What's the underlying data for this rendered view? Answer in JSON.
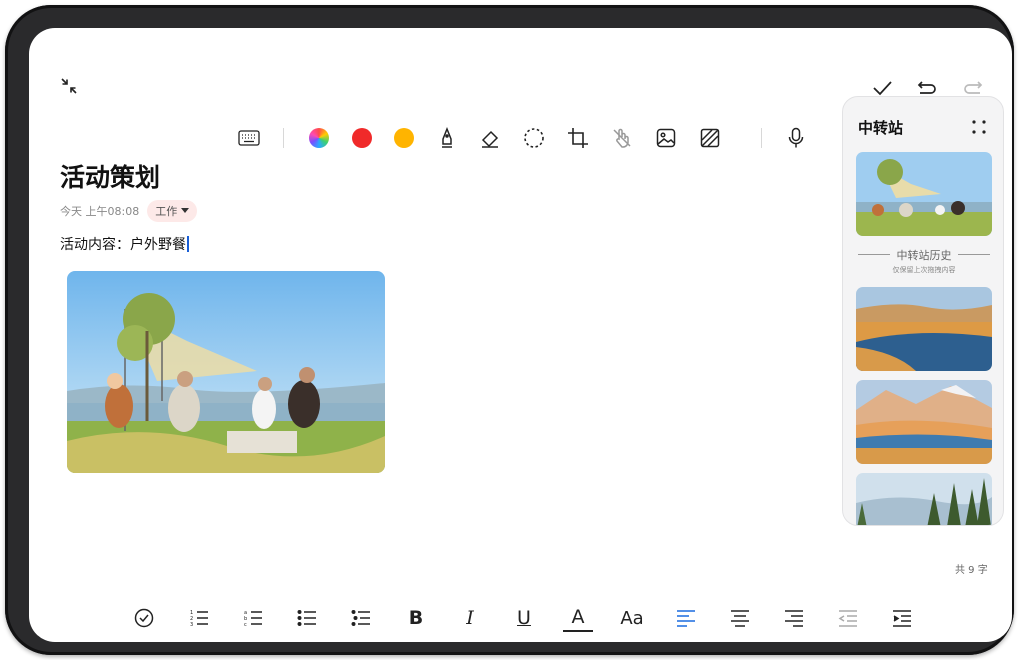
{
  "note": {
    "title": "活动策划",
    "time": "今天 上午08:08",
    "tag": "工作",
    "content": "活动内容：户外野餐"
  },
  "top_toolbar": {
    "icons": [
      "keyboard-icon",
      "color-wheel-icon",
      "red-color",
      "yellow-color",
      "pen-icon",
      "eraser-icon",
      "lasso-icon",
      "crop-icon",
      "hand-off-icon",
      "image-icon",
      "pattern-icon",
      "microphone-icon"
    ],
    "colors": {
      "red": "#f02a2a",
      "yellow": "#ffb400"
    }
  },
  "window_controls": {
    "icons": [
      "collapse-icon",
      "check-icon",
      "undo-icon",
      "redo-icon"
    ]
  },
  "transfer_panel": {
    "title": "中转站",
    "history_label": "中转站历史",
    "history_note": "仅保留上次拖拽内容"
  },
  "footer": {
    "word_count": "共 9 字"
  },
  "bottom_toolbar": {
    "items": [
      "checklist-icon",
      "numbered-list-icon",
      "lettered-list-icon",
      "bullet-list-icon",
      "indent-list-icon",
      "B",
      "I",
      "U",
      "A",
      "Aa",
      "align-left-icon",
      "align-center-icon",
      "align-right-icon",
      "outdent-icon",
      "indent-icon"
    ],
    "bold": "B",
    "italic": "I",
    "underline": "U",
    "font_color": "A",
    "font_size": "Aa",
    "accent": "#1a6bdf"
  }
}
